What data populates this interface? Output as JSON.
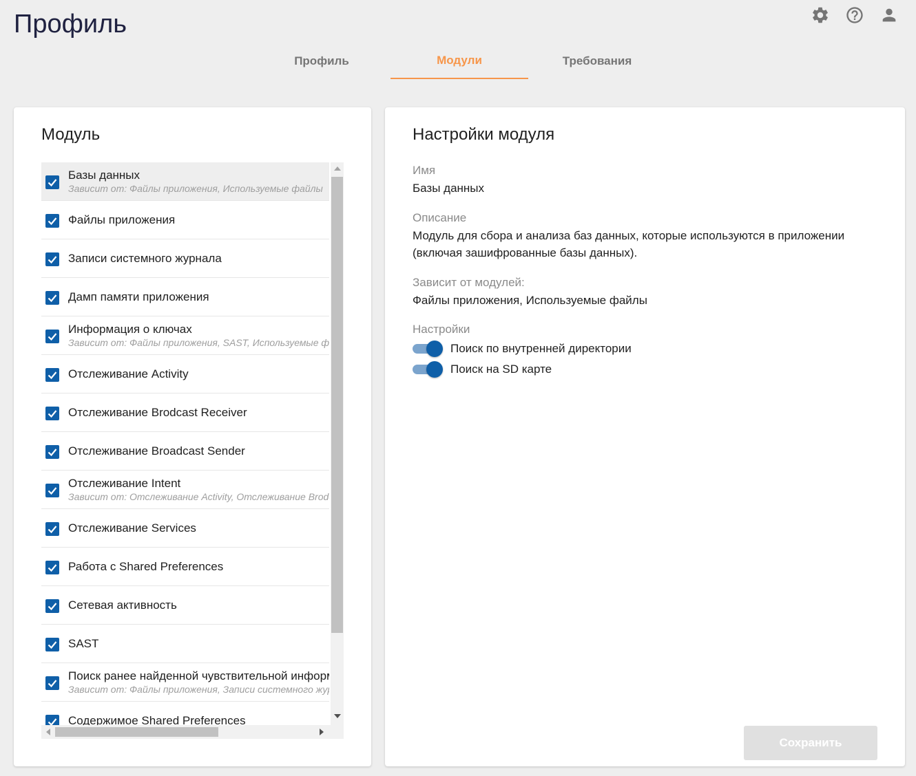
{
  "page": {
    "title": "Профиль"
  },
  "tabs": [
    {
      "label": "Профиль",
      "active": false
    },
    {
      "label": "Модули",
      "active": true
    },
    {
      "label": "Требования",
      "active": false
    }
  ],
  "top_icons": [
    "gear-icon",
    "help-icon",
    "user-icon"
  ],
  "module_panel": {
    "title": "Модуль",
    "items": [
      {
        "label": "Базы данных",
        "dep": "Зависит от:  Файлы приложения, Используемые файлы",
        "checked": true,
        "selected": true
      },
      {
        "label": "Файлы приложения",
        "dep": "",
        "checked": true
      },
      {
        "label": "Записи системного журнала",
        "dep": "",
        "checked": true
      },
      {
        "label": "Дамп памяти приложения",
        "dep": "",
        "checked": true
      },
      {
        "label": "Информация о ключах",
        "dep": "Зависит от:  Файлы приложения, SAST, Используемые файлы",
        "checked": true
      },
      {
        "label": "Отслеживание Activity",
        "dep": "",
        "checked": true
      },
      {
        "label": "Отслеживание Brodcast Receiver",
        "dep": "",
        "checked": true
      },
      {
        "label": "Отслеживание Broadcast Sender",
        "dep": "",
        "checked": true
      },
      {
        "label": "Отслеживание Intent",
        "dep": "Зависит от:  Отслеживание Activity, Отслеживание Brodcast Receiver",
        "checked": true
      },
      {
        "label": "Отслеживание Services",
        "dep": "",
        "checked": true
      },
      {
        "label": "Работа с Shared Preferences",
        "dep": "",
        "checked": true
      },
      {
        "label": "Сетевая активность",
        "dep": "",
        "checked": true
      },
      {
        "label": "SAST",
        "dep": "",
        "checked": true
      },
      {
        "label": "Поиск ранее найденной чувствительной информации",
        "dep": "Зависит от:  Файлы приложения, Записи системного журнала",
        "checked": true
      },
      {
        "label": "Содержимое Shared Preferences",
        "dep": "",
        "checked": true
      }
    ]
  },
  "settings_panel": {
    "title": "Настройки модуля",
    "name_label": "Имя",
    "name_value": "Базы данных",
    "desc_label": "Описание",
    "desc_value": "Модуль для сбора и анализа баз данных, которые используются в приложении (включая зашифрованные базы данных).",
    "deps_label": "Зависит от модулей:",
    "deps_value": "Файлы приложения, Используемые файлы",
    "settings_label": "Настройки",
    "toggles": [
      {
        "label": "Поиск по внутренней директории",
        "on": true
      },
      {
        "label": "Поиск на SD карте",
        "on": true
      }
    ],
    "save_label": "Сохранить"
  },
  "colors": {
    "accent": "#f7964a",
    "primary": "#0f5fa8",
    "title": "#1f2140"
  }
}
